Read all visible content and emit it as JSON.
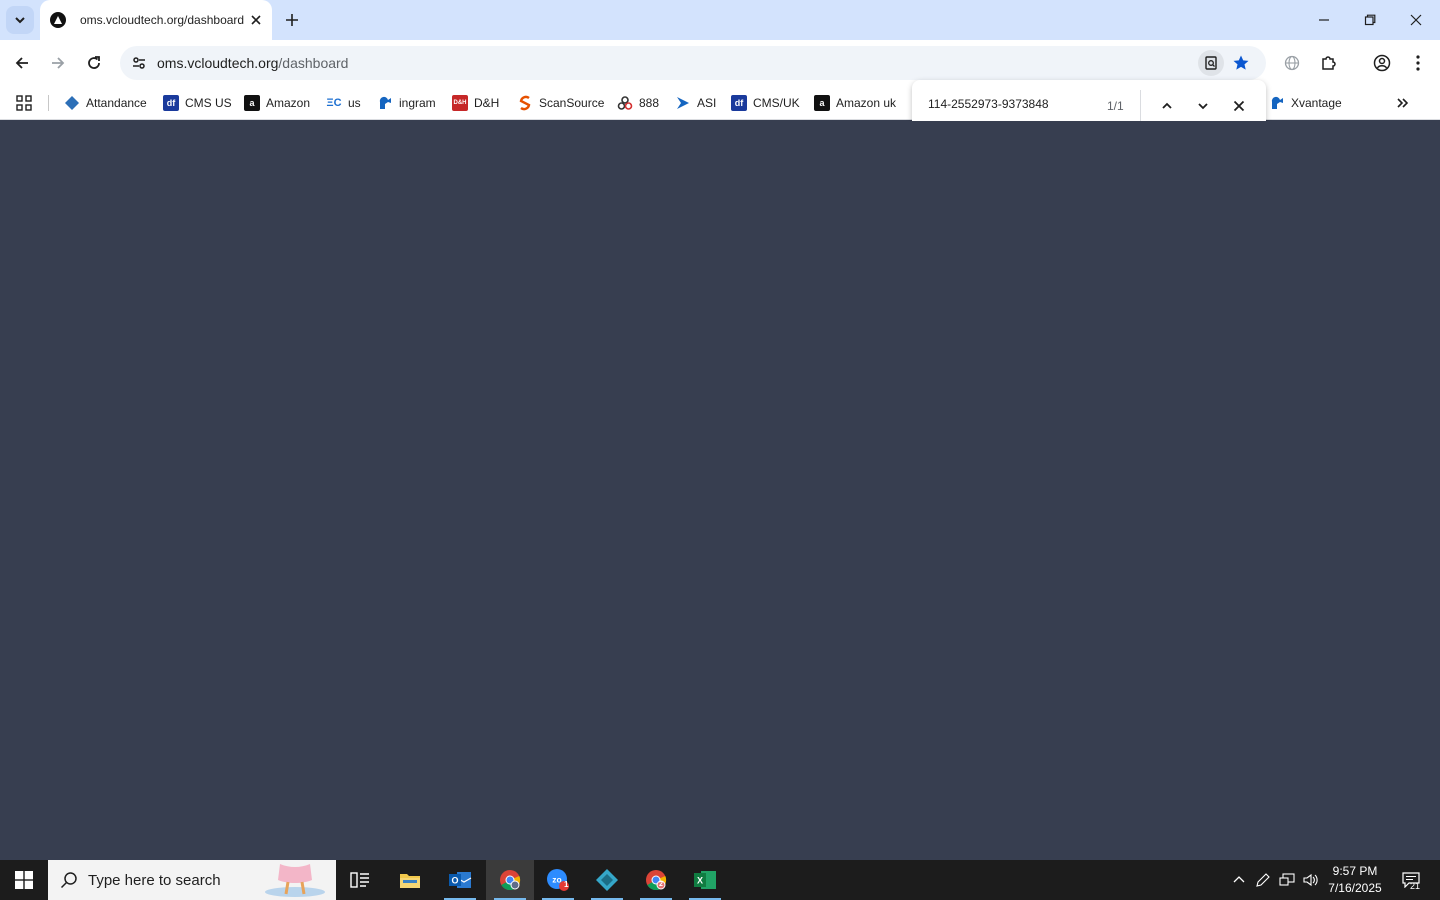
{
  "browser": {
    "tab": {
      "title": "oms.vcloudtech.org/dashboard"
    },
    "address_bar": {
      "host": "oms.vcloudtech.org",
      "path": "/dashboard"
    }
  },
  "bookmarks": [
    {
      "label": "Attandance",
      "icon": "diamond-app-icon",
      "color": "#2c6fb7"
    },
    {
      "label": "CMS US",
      "icon": "df-icon",
      "color": "#1a3a9c"
    },
    {
      "label": "Amazon",
      "icon": "amazon-icon",
      "color": "#111111"
    },
    {
      "label": "us",
      "icon": "synnex-icon",
      "color": "#1c6fd1"
    },
    {
      "label": "ingram",
      "icon": "ingram-icon",
      "color": "#1565c0"
    },
    {
      "label": "D&H",
      "icon": "dh-icon",
      "color": "#c62828"
    },
    {
      "label": "ScanSource",
      "icon": "scansource-icon",
      "color": "#e65100"
    },
    {
      "label": "888",
      "icon": "888-icon",
      "color": "#333333"
    },
    {
      "label": "ASI",
      "icon": "asi-icon",
      "color": "#1565c0"
    },
    {
      "label": "CMS/UK",
      "icon": "df-icon",
      "color": "#1a3a9c"
    },
    {
      "label": "Amazon uk",
      "icon": "amazon-icon",
      "color": "#111111"
    },
    {
      "label": "Xvantage",
      "icon": "ingram-icon",
      "color": "#1565c0"
    }
  ],
  "findbar": {
    "query": "114-2552973-9373848",
    "count": "1/1"
  },
  "taskbar": {
    "search_placeholder": "Type here to search",
    "apps": [
      "task-view-icon",
      "file-explorer-icon",
      "outlook-icon",
      "chrome-icon",
      "zoom-icon",
      "app-diamond-icon",
      "chrome-icon",
      "excel-icon"
    ],
    "zoom_badge": "1",
    "chrome_badge": "2",
    "time": "9:57 PM",
    "date": "7/16/2025",
    "notification_count": "21"
  }
}
